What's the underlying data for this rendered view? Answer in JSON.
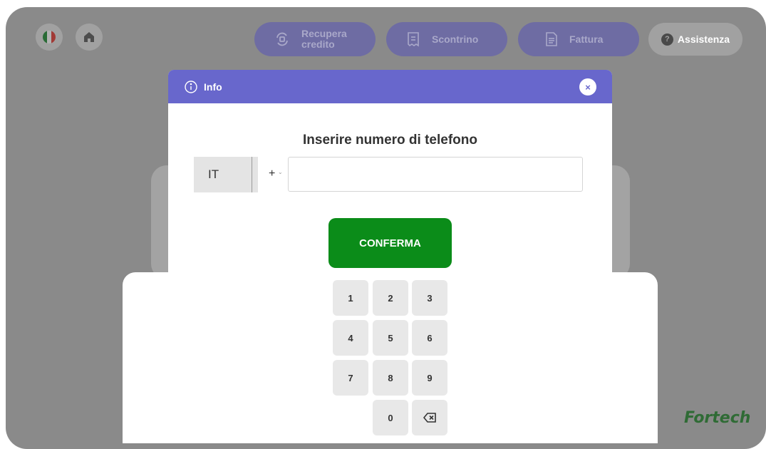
{
  "topbar": {
    "recupera_label": "Recupera credito",
    "recupera_line1": "Recupera",
    "recupera_line2": "credito",
    "scontrino_label": "Scontrino",
    "fattura_label": "Fattura",
    "assistenza_label": "Assistenza",
    "assistenza_icon_text": "?"
  },
  "modal": {
    "title": "Info",
    "close_glyph": "×",
    "heading": "Inserire numero di telefono",
    "country": "IT",
    "prefix": "+",
    "phone_value": "",
    "confirm_label": "CONFERMA"
  },
  "keypad": {
    "keys": [
      "1",
      "2",
      "3",
      "4",
      "5",
      "6",
      "7",
      "8",
      "9",
      "0"
    ],
    "backspace_icon": "backspace-icon"
  },
  "brand": {
    "logo": "Fortech"
  },
  "colors": {
    "header": "#6867cc",
    "confirm": "#0b8c19",
    "overlay": "#8a8a8a",
    "pill": "#6e6ca3",
    "logo": "#2f6b35"
  },
  "icons": [
    "italy-flag-icon",
    "home-icon",
    "refresh-icon",
    "receipt-icon",
    "invoice-icon",
    "help-icon",
    "info-icon",
    "close-icon"
  ]
}
